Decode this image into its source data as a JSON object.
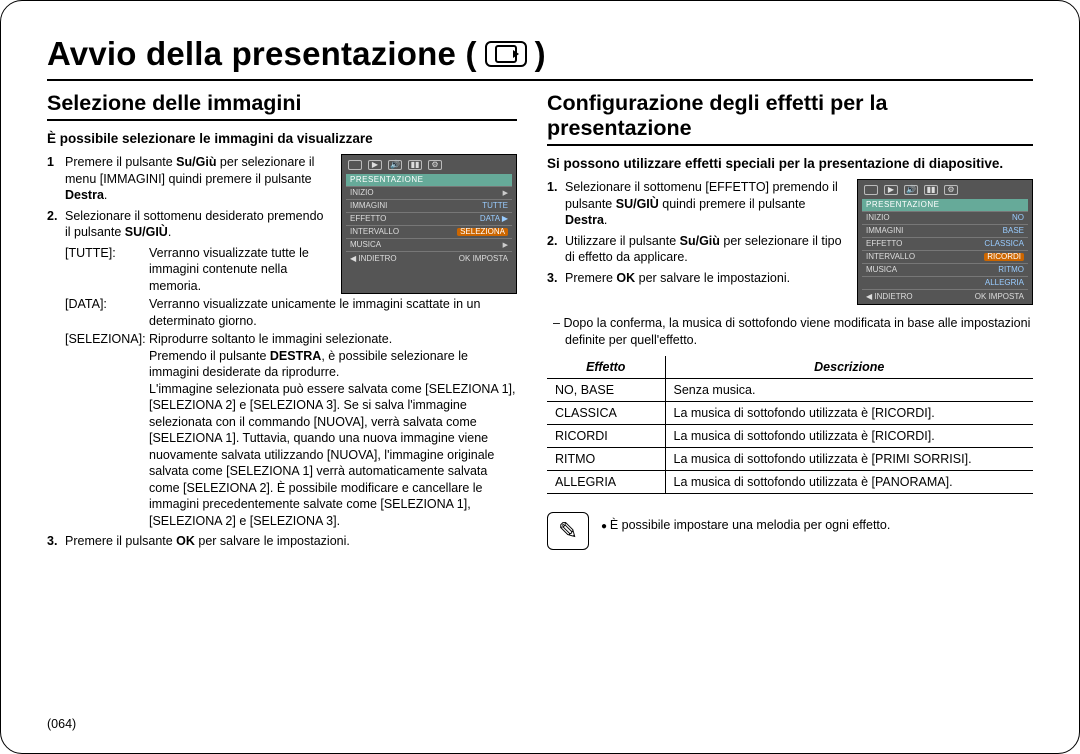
{
  "page_title": "Avvio della presentazione (",
  "page_title_close": ")",
  "page_number": "064",
  "left": {
    "section_title": "Selezione delle immagini",
    "lead": "È possibile selezionare le immagini da visualizzare",
    "step1_num": "1",
    "step1_a": "Premere il pulsante ",
    "step1_b": "Su/Giù",
    "step1_c": " per selezionare il menu [IMMAGINI] quindi premere il pulsante ",
    "step1_d": "Destra",
    "step1_e": ".",
    "step2_num": "2.",
    "step2_a": "Selezionare il sottomenu desiderato premendo il pulsante ",
    "step2_b": "SU/GIÙ",
    "step2_c": ".",
    "def_tutte_term": "[TUTTE]:",
    "def_tutte_desc": "Verranno visualizzate tutte le immagini contenute nella memoria.",
    "def_data_term": "[DATA]:",
    "def_data_desc": "Verranno visualizzate unicamente le immagini scattate in un determinato giorno.",
    "def_sel_term": "[SELEZIONA]:",
    "def_sel_desc1": "Riprodurre soltanto le immagini selezionate.",
    "def_sel_desc2a": "Premendo il pulsante ",
    "def_sel_desc2b": "DESTRA",
    "def_sel_desc2c": ", è possibile selezionare le immagini desiderate da riprodurre.",
    "def_sel_desc3": "L'immagine selezionata può essere salvata come [SELEZIONA 1], [SELEZIONA 2] e [SELEZIONA 3]. Se si salva l'immagine selezionata con il commando [NUOVA], verrà salvata come [SELEZIONA 1]. Tuttavia, quando una nuova immagine viene nuovamente salvata utilizzando [NUOVA], l'immagine originale salvata come [SELEZIONA 1] verrà automaticamente salvata come [SELEZIONA 2]. È possibile modificare e cancellare le immagini precedentemente salvate come [SELEZIONA 1], [SELEZIONA 2] e [SELEZIONA 3].",
    "step3_num": "3.",
    "step3_a": "Premere il pulsante ",
    "step3_b": "OK",
    "step3_c": " per salvare le impostazioni.",
    "lcd": {
      "header": "PRESENTAZIONE",
      "rows": [
        {
          "l": "INIZIO",
          "r": "",
          "arrow": true
        },
        {
          "l": "IMMAGINI",
          "r": "TUTTE",
          "arrow": true
        },
        {
          "l": "EFFETTO",
          "r": "DATA ▶",
          "arrow": false
        },
        {
          "l": "INTERVALLO",
          "r": "SELEZIONA",
          "arrow": false,
          "sel": true
        },
        {
          "l": "MUSICA",
          "r": "",
          "arrow": true
        }
      ],
      "foot_l": "INDIETRO",
      "foot_r": "OK  IMPOSTA"
    }
  },
  "right": {
    "section_title": "Configurazione degli effetti per la presentazione",
    "lead": "Si possono utilizzare effetti speciali per la presentazione di diapositive.",
    "step1_num": "1.",
    "step1_a": "Selezionare il sottomenu [EFFETTO] premendo il pulsante ",
    "step1_b": "SU/GIÙ",
    "step1_c": " quindi premere il pulsante ",
    "step1_d": "Destra",
    "step1_e": ".",
    "step2_num": "2.",
    "step2_a": "Utilizzare il pulsante ",
    "step2_b": "Su/Giù",
    "step2_c": " per selezionare il tipo di effetto da applicare.",
    "step3_num": "3.",
    "step3_a": "Premere ",
    "step3_b": "OK",
    "step3_c": " per salvare le impostazioni.",
    "after": "Dopo la conferma, la musica di sottofondo viene modificata in base alle impostazioni definite per quell'effetto.",
    "table": {
      "head_eff": "Effetto",
      "head_desc": "Descrizione",
      "rows": [
        {
          "eff": "NO, BASE",
          "desc": "Senza musica."
        },
        {
          "eff": "CLASSICA",
          "desc": "La musica di sottofondo utilizzata è [RICORDI]."
        },
        {
          "eff": "RICORDI",
          "desc": "La musica di sottofondo utilizzata è [RICORDI]."
        },
        {
          "eff": "RITMO",
          "desc": "La musica di sottofondo utilizzata è [PRIMI SORRISI]."
        },
        {
          "eff": "ALLEGRIA",
          "desc": "La musica di sottofondo utilizzata è [PANORAMA]."
        }
      ]
    },
    "note": "È possibile impostare una melodia per ogni effetto.",
    "lcd": {
      "header": "PRESENTAZIONE",
      "rows": [
        {
          "l": "INIZIO",
          "r": "NO",
          "arrow": true
        },
        {
          "l": "IMMAGINI",
          "r": "BASE",
          "arrow": true
        },
        {
          "l": "EFFETTO",
          "r": "CLASSICA",
          "arrow": true
        },
        {
          "l": "INTERVALLO",
          "r": "RICORDI",
          "arrow": false,
          "sel": true
        },
        {
          "l": "MUSICA",
          "r": "RITMO",
          "arrow": true
        },
        {
          "l": "",
          "r": "ALLEGRIA",
          "arrow": false
        }
      ],
      "foot_l": "INDIETRO",
      "foot_r": "OK  IMPOSTA"
    }
  }
}
